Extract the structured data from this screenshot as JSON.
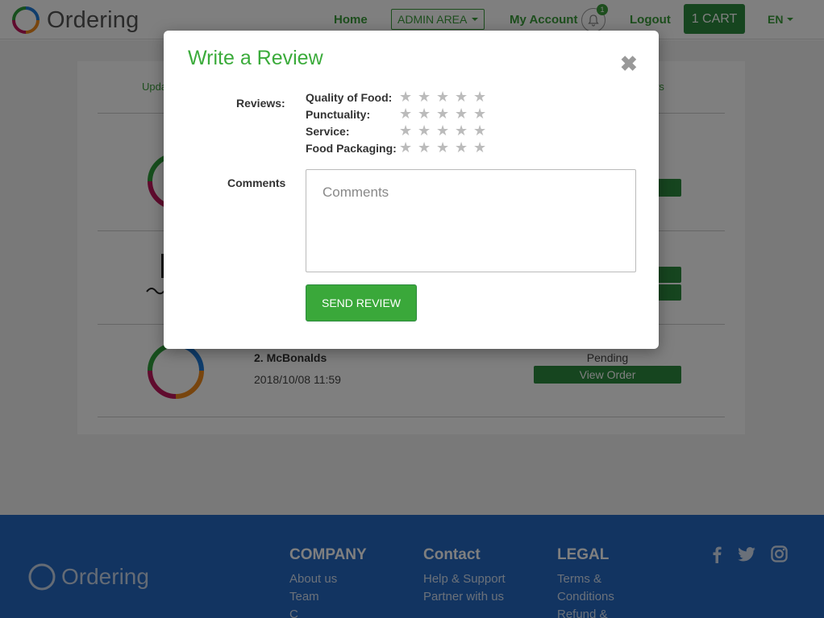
{
  "header": {
    "logo_text": "Ordering",
    "nav": {
      "home": "Home",
      "admin_area": "ADMIN AREA",
      "my_account": "My Account",
      "notification_count": "1",
      "logout": "Logout",
      "cart": "1 CART",
      "language": "EN"
    }
  },
  "orders": {
    "tabs": {
      "left": "Upda",
      "right": "ws"
    },
    "items": [
      {
        "name": "2. McBonalds",
        "date": "2018/10/08 11:59",
        "status": "Pending",
        "action": "View Order"
      }
    ]
  },
  "modal": {
    "title": "Write a Review",
    "close_icon": "close-icon",
    "reviews_label": "Reviews:",
    "criteria": [
      {
        "label": "Quality of Food:",
        "rating": 0,
        "max": 5
      },
      {
        "label": "Punctuality:",
        "rating": 0,
        "max": 5
      },
      {
        "label": "Service:",
        "rating": 0,
        "max": 5
      },
      {
        "label": "Food Packaging:",
        "rating": 0,
        "max": 5
      }
    ],
    "comments_label": "Comments",
    "comments_placeholder": "Comments",
    "comments_value": "",
    "send_button": "SEND REVIEW"
  },
  "footer": {
    "logo_text": "Ordering",
    "company": {
      "heading": "COMPANY",
      "links": [
        "About us",
        "Team",
        "C"
      ]
    },
    "contact": {
      "heading": "Contact",
      "links": [
        "Help & Support",
        "Partner with us"
      ]
    },
    "legal": {
      "heading": "LEGAL",
      "links": [
        "Terms &",
        "Conditions",
        "Refund &"
      ]
    },
    "social": [
      "facebook-icon",
      "twitter-icon",
      "instagram-icon"
    ]
  },
  "colors": {
    "brand_green": "#2d8a3e",
    "title_green": "#3bab3b",
    "footer_blue": "#2468c2",
    "star_gray": "#bbbbbb"
  }
}
